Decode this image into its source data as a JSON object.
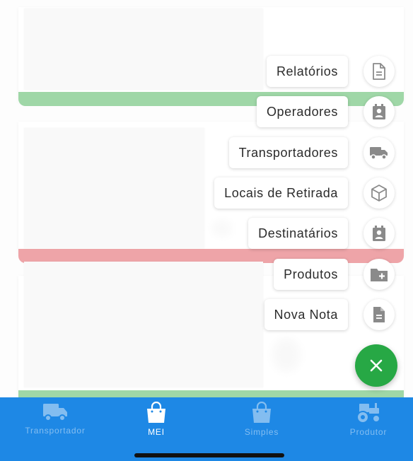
{
  "speed_dial": {
    "items": [
      {
        "label": "Relatórios",
        "icon": "document-outline-icon"
      },
      {
        "label": "Operadores",
        "icon": "contact-badge-icon"
      },
      {
        "label": "Transportadores",
        "icon": "truck-icon"
      },
      {
        "label": "Locais de Retirada",
        "icon": "cube-outline-icon"
      },
      {
        "label": "Destinatários",
        "icon": "contact-badge-icon"
      },
      {
        "label": "Produtos",
        "icon": "folder-plus-icon"
      },
      {
        "label": "Nova Nota",
        "icon": "document-filled-icon"
      }
    ],
    "close_icon": "close-icon"
  },
  "bottom_nav": {
    "items": [
      {
        "label": "Transportador",
        "icon": "truck-icon",
        "active": false
      },
      {
        "label": "MEI",
        "icon": "shopping-bag-icon",
        "active": true
      },
      {
        "label": "Simples",
        "icon": "shopping-bag-icon",
        "active": false
      },
      {
        "label": "Produtor",
        "icon": "tractor-icon",
        "active": false
      }
    ]
  },
  "colors": {
    "fab_green": "#27a845",
    "stripe_green": "#2aa63c",
    "stripe_red": "#d9363e",
    "nav_blue": "#1e88e5",
    "icon_grey": "#9e9e9e"
  }
}
